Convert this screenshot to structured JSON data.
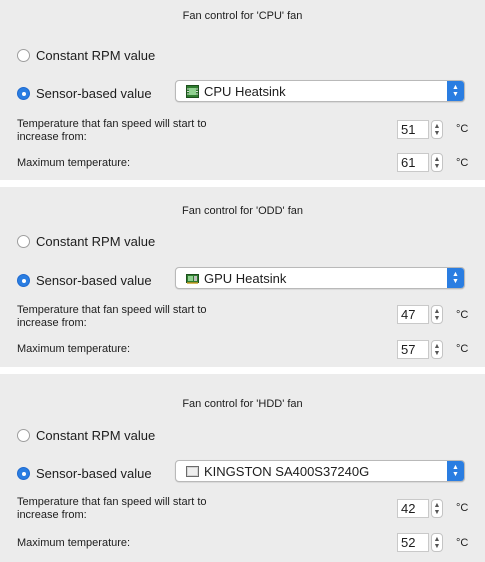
{
  "unit": "°C",
  "radio_constant_label": "Constant RPM value",
  "radio_sensor_label": "Sensor-based value",
  "start_temp_label_line1": "Temperature that fan speed will start to",
  "start_temp_label_line2": "increase from:",
  "max_temp_label": "Maximum temperature:",
  "sections": [
    {
      "title": "Fan control for 'CPU' fan",
      "sensor": "CPU Heatsink",
      "sensor_icon": "chip-icon",
      "start_temp": "51",
      "max_temp": "61",
      "selected_mode": "sensor"
    },
    {
      "title": "Fan control for 'ODD' fan",
      "sensor": "GPU Heatsink",
      "sensor_icon": "gpu-card-icon",
      "start_temp": "47",
      "max_temp": "57",
      "selected_mode": "sensor"
    },
    {
      "title": "Fan control for 'HDD' fan",
      "sensor": "KINGSTON SA400S37240G",
      "sensor_icon": "drive-icon",
      "start_temp": "42",
      "max_temp": "52",
      "selected_mode": "sensor"
    }
  ],
  "colors": {
    "accent": "#2a7de1",
    "background": "#ececec",
    "separator": "#ffffff"
  }
}
